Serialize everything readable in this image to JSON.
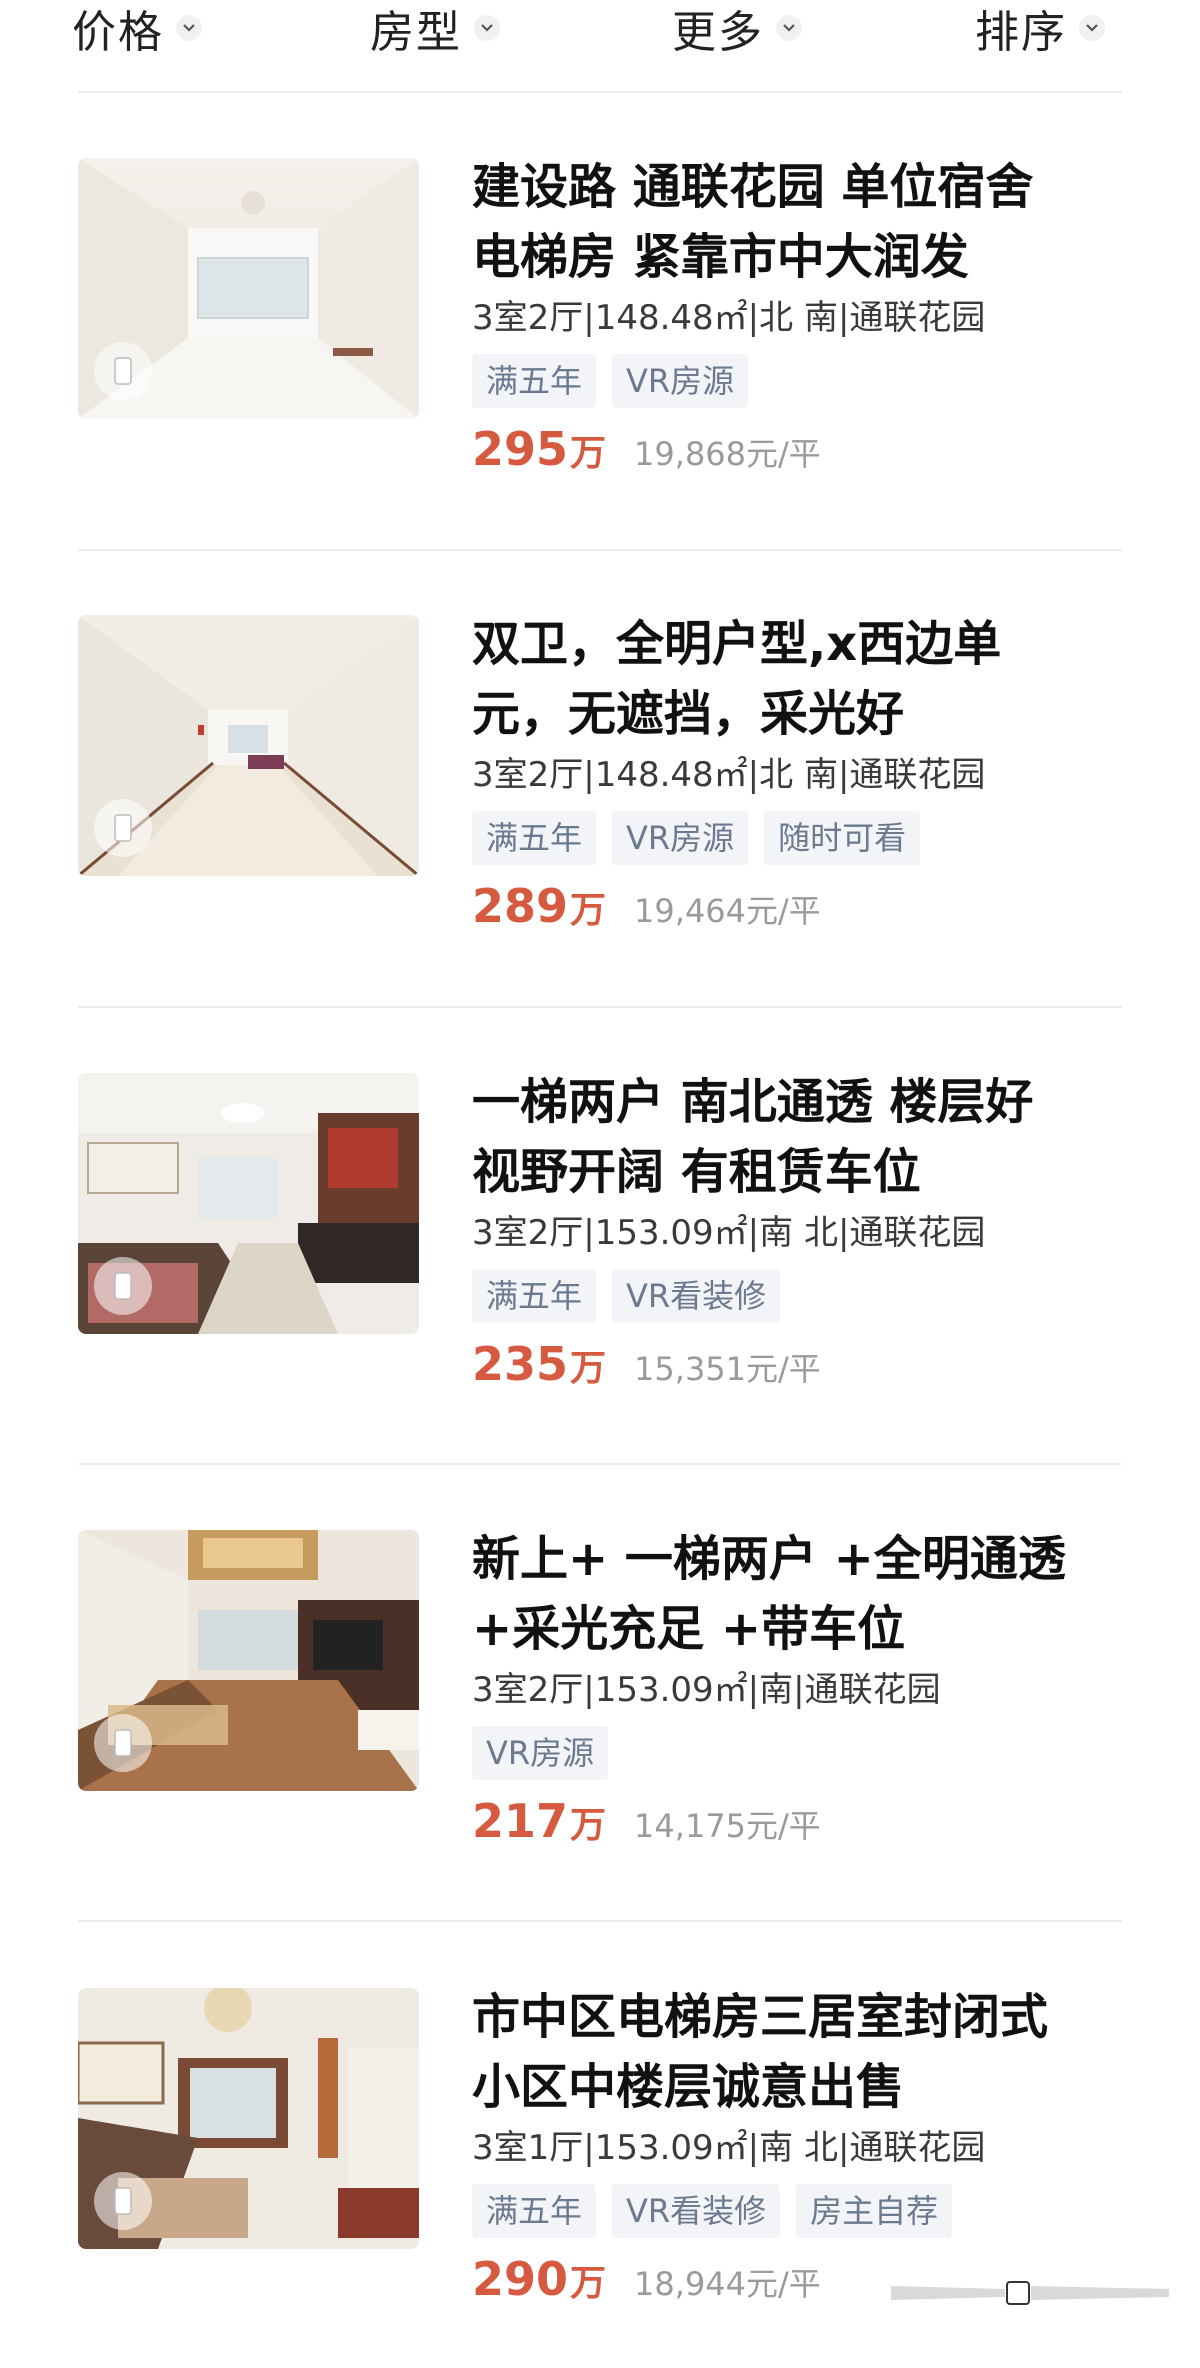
{
  "filters": [
    {
      "label": "价格"
    },
    {
      "label": "房型"
    },
    {
      "label": "更多"
    },
    {
      "label": "排序"
    }
  ],
  "listings": [
    {
      "title_line1": "建设路 通联花园 单位宿舍",
      "title_line2": "电梯房 紧靠市中大润发",
      "meta": "3室2厅|148.48㎡|北 南|通联花园",
      "tags": [
        "满五年",
        "VR房源"
      ],
      "price": "295",
      "price_unit": "万",
      "unit_price": "19,868元/平"
    },
    {
      "title_line1": "双卫，全明户型,x西边单",
      "title_line2": "元，无遮挡，采光好",
      "meta": "3室2厅|148.48㎡|北 南|通联花园",
      "tags": [
        "满五年",
        "VR房源",
        "随时可看"
      ],
      "price": "289",
      "price_unit": "万",
      "unit_price": "19,464元/平"
    },
    {
      "title_line1": "一梯两户 南北通透 楼层好",
      "title_line2": "视野开阔 有租赁车位",
      "meta": "3室2厅|153.09㎡|南 北|通联花园",
      "tags": [
        "满五年",
        "VR看装修"
      ],
      "price": "235",
      "price_unit": "万",
      "unit_price": "15,351元/平"
    },
    {
      "title_line1": "新上+ 一梯两户 +全明通透",
      "title_line2": "+采光充足  +带车位",
      "meta": "3室2厅|153.09㎡|南|通联花园",
      "tags": [
        "VR房源"
      ],
      "price": "217",
      "price_unit": "万",
      "unit_price": "14,175元/平"
    },
    {
      "title_line1": "市中区电梯房三居室封闭式",
      "title_line2": "小区中楼层诚意出售",
      "meta": "3室1厅|153.09㎡|南 北|通联花园",
      "tags": [
        "满五年",
        "VR看装修",
        "房主自荐"
      ],
      "price": "290",
      "price_unit": "万",
      "unit_price": "18,944元/平"
    }
  ],
  "colors": {
    "price": "#d65a3f",
    "tag_bg": "#f2f4f7",
    "tag_text": "#6b7a90"
  },
  "icons": {
    "filter_chevron": "chevron-down-icon",
    "vr_badge": "vr-icon"
  }
}
